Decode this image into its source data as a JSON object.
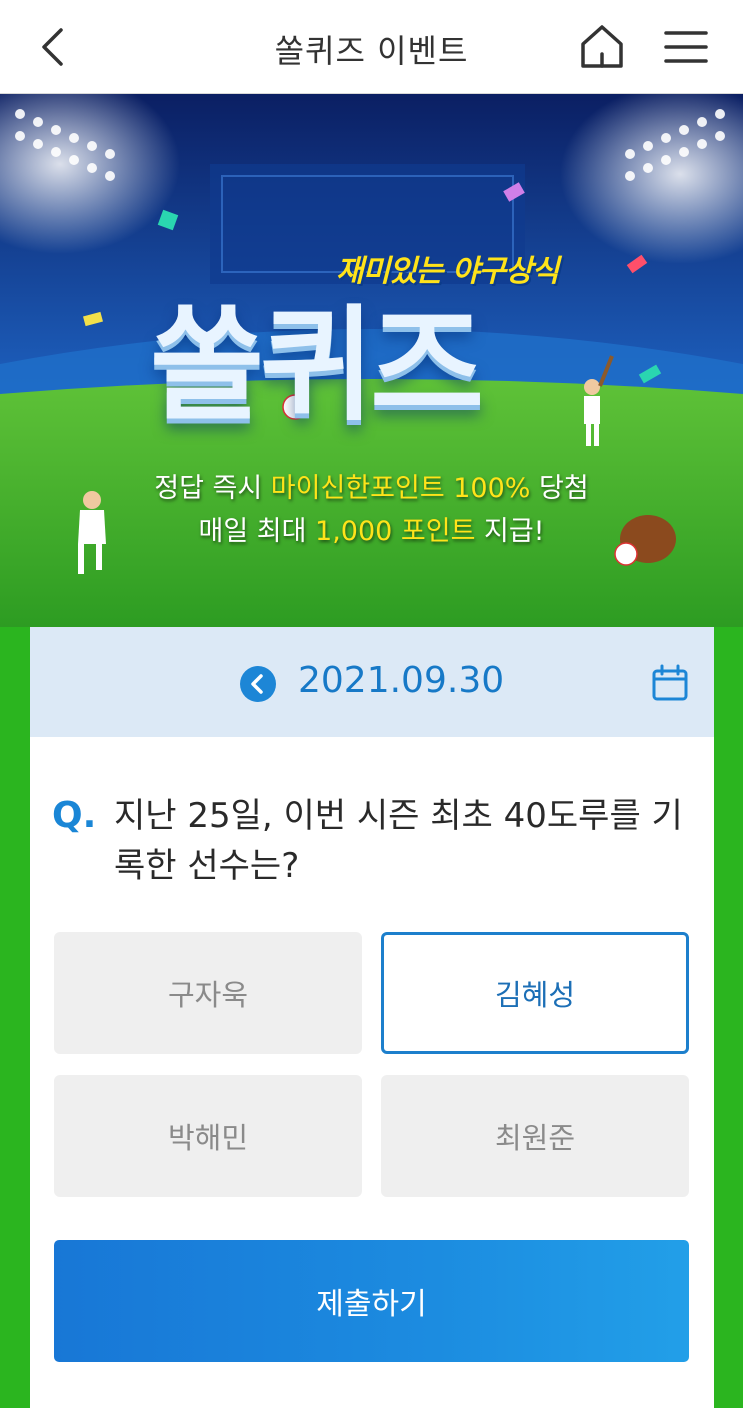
{
  "header": {
    "title": "쏠퀴즈 이벤트",
    "back_icon": "chevron-left-icon",
    "home_icon": "home-icon",
    "menu_icon": "hamburger-menu-icon"
  },
  "banner": {
    "subtitle": "재미있는 야구상식",
    "title": "쏠퀴즈",
    "line1_pre": "정답 즉시 ",
    "line1_hl": "마이신한포인트 100%",
    "line1_post": " 당첨",
    "line2_pre": "매일 최대 ",
    "line2_hl": "1,000 포인트",
    "line2_post": " 지급!"
  },
  "quiz": {
    "date": "2021.09.30",
    "prev_icon": "circle-chevron-left-icon",
    "calendar_icon": "calendar-icon",
    "q_mark": "Q.",
    "question": "지난 25일, 이번 시즌 최초 40도루를 기록한 선수는?",
    "options": [
      {
        "label": "구자욱",
        "selected": false
      },
      {
        "label": "김혜성",
        "selected": true
      },
      {
        "label": "박해민",
        "selected": false
      },
      {
        "label": "최원준",
        "selected": false
      }
    ],
    "submit_label": "제출하기"
  },
  "colors": {
    "accent": "#1d7fcc",
    "field_green": "#2bb51f",
    "highlight_yellow": "#ffe31a",
    "date_bar": "#dce9f6"
  }
}
